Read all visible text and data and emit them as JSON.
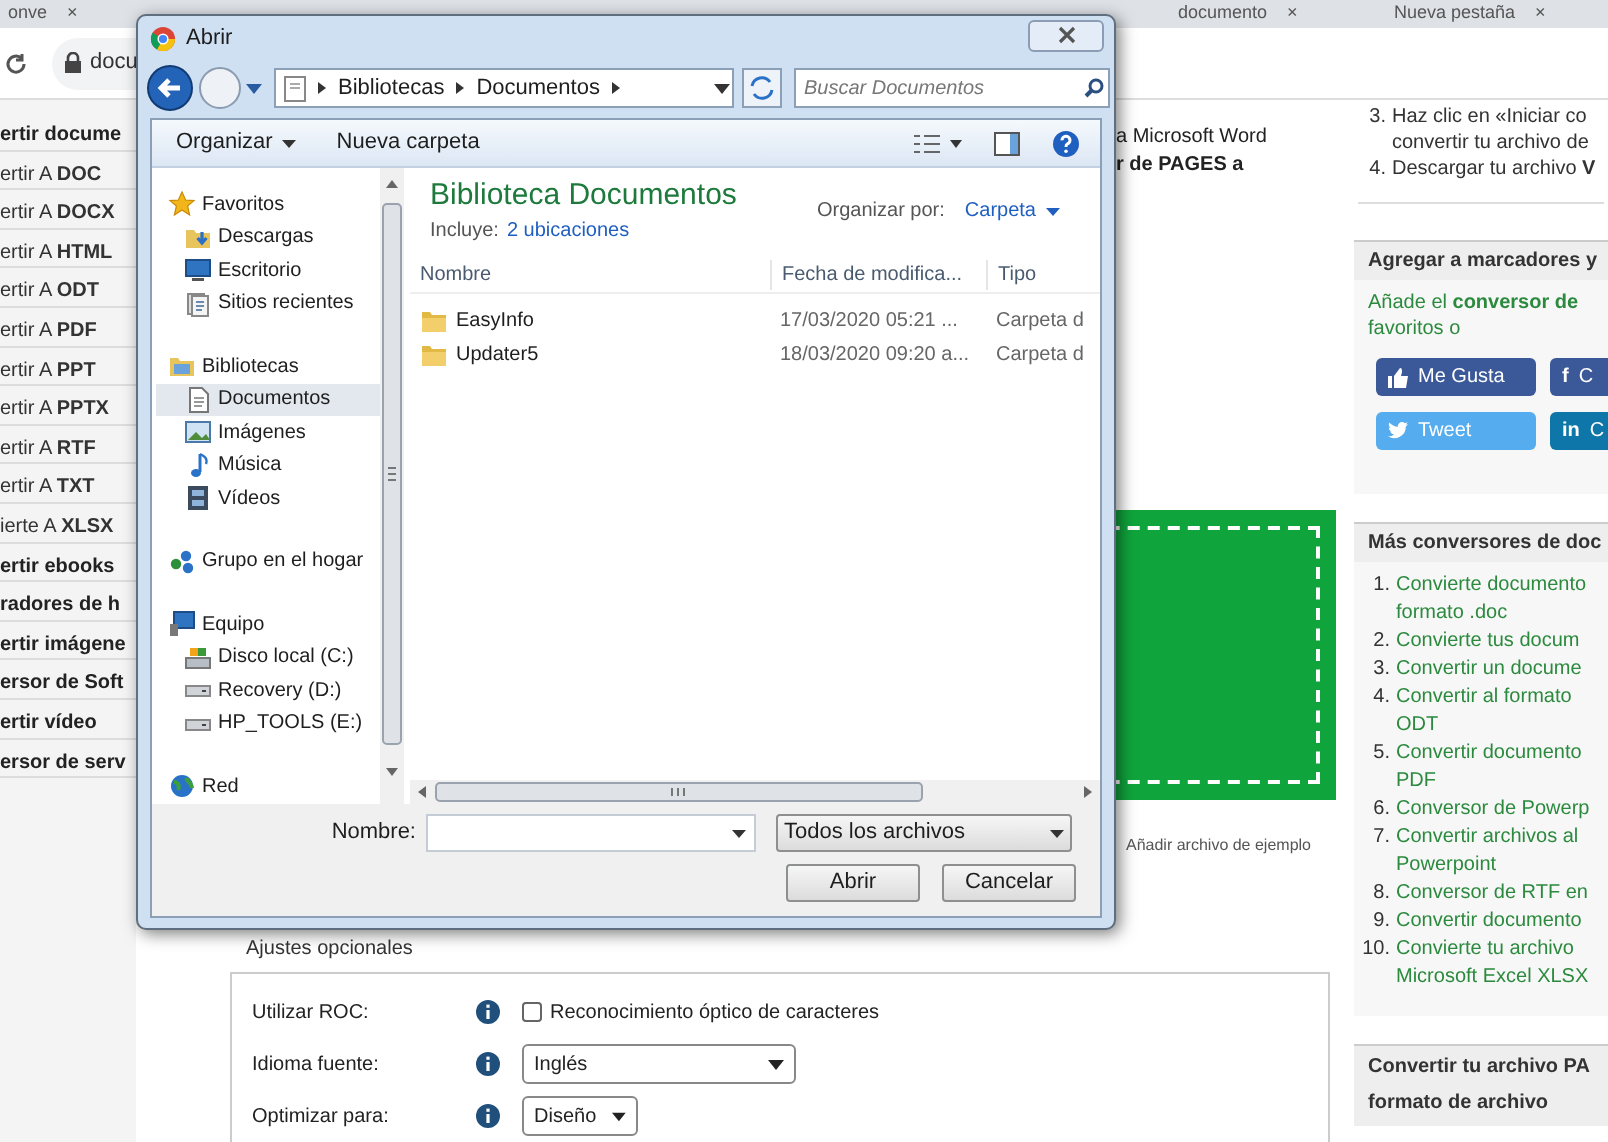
{
  "browser": {
    "tabs": [
      {
        "label": "onve",
        "close": "×"
      },
      {
        "label": "documento",
        "close": "×"
      },
      {
        "label": "Nueva pestaña",
        "close": "×"
      }
    ],
    "address": "docu"
  },
  "sidebar": {
    "items": [
      {
        "kind": "heading",
        "text": "**ertir docume**"
      },
      {
        "kind": "link",
        "text": "ertir A **DOC**"
      },
      {
        "kind": "link",
        "text": "ertir A **DOCX**"
      },
      {
        "kind": "link",
        "text": "ertir A **HTML**"
      },
      {
        "kind": "link",
        "text": "ertir A **ODT**"
      },
      {
        "kind": "link",
        "text": "ertir A **PDF**"
      },
      {
        "kind": "link",
        "text": "ertir A **PPT**"
      },
      {
        "kind": "link",
        "text": "ertir A **PPTX**"
      },
      {
        "kind": "link",
        "text": "ertir A **RTF**"
      },
      {
        "kind": "link",
        "text": "ertir A **TXT**"
      },
      {
        "kind": "link",
        "text": "ierte A **XLSX**"
      },
      {
        "kind": "heading",
        "text": "**ertir ebooks**"
      },
      {
        "kind": "heading",
        "text": "**radores de h**"
      },
      {
        "kind": "heading",
        "text": "**ertir imágene**"
      },
      {
        "kind": "heading",
        "text": "**ersor de Soft**"
      },
      {
        "kind": "heading",
        "text": "**ertir vídeo**"
      },
      {
        "kind": "heading",
        "text": "**ersor de serv**"
      }
    ]
  },
  "content": {
    "lines": [
      "a Microsoft Word",
      "**r de PAGES a**"
    ],
    "sample_link": "Añadir archivo de ejemplo",
    "options": {
      "title": "Ajustes opcionales",
      "rows": [
        {
          "kind": "checkbox",
          "label": "Utilizar ROC:",
          "text": "Reconocimiento óptico de caracteres",
          "checked": false
        },
        {
          "kind": "select",
          "label": "Idioma fuente:",
          "value": "Inglés"
        },
        {
          "kind": "select",
          "label": "Optimizar para:",
          "value": "Diseño"
        }
      ]
    }
  },
  "right_column": {
    "steps": [
      {
        "number": "3.",
        "lines": [
          "Haz clic en «Iniciar co",
          "convertir tu archivo de"
        ]
      },
      {
        "number": "4.",
        "lines": [
          "Descargar tu archivo **V**"
        ]
      }
    ],
    "bookmarks": {
      "title": "Agregar a marcadores y",
      "lines": [
        "Añade el **conversor de**",
        "favoritos o"
      ],
      "buttons": [
        {
          "kind": "like",
          "label": "Me Gusta",
          "color": "#3b5998"
        },
        {
          "kind": "letter",
          "glyph": "f",
          "label": "C",
          "color": "#3b5998"
        },
        {
          "kind": "tweet",
          "label": "Tweet",
          "color": "#55acee"
        },
        {
          "kind": "letter",
          "glyph": "in",
          "label": "C",
          "color": "#0e76a8"
        }
      ]
    },
    "more_converters": {
      "title": "Más conversores de doc",
      "items": [
        {
          "number": "1.",
          "lines": [
            "Convierte documento",
            "formato .doc"
          ]
        },
        {
          "number": "2.",
          "lines": [
            "Convierte tus docum"
          ]
        },
        {
          "number": "3.",
          "lines": [
            "Convertir un docume"
          ]
        },
        {
          "number": "4.",
          "lines": [
            "Convertir al formato",
            "ODT"
          ]
        },
        {
          "number": "5.",
          "lines": [
            "Convertir documento",
            "PDF"
          ]
        },
        {
          "number": "6.",
          "lines": [
            "Conversor de Powerp"
          ]
        },
        {
          "number": "7.",
          "lines": [
            "Convertir archivos al",
            "Powerpoint"
          ]
        },
        {
          "number": "8.",
          "lines": [
            "Conversor de RTF en"
          ]
        },
        {
          "number": "9.",
          "lines": [
            "Convertir documento"
          ]
        },
        {
          "number": "10.",
          "lines": [
            "Convierte tu archivo",
            "Microsoft Excel XLSX"
          ]
        }
      ]
    },
    "convert_box": {
      "lines": [
        "Convertir tu archivo PA",
        "formato de archivo"
      ]
    }
  },
  "dialog": {
    "title": "Abrir",
    "breadcrumb": [
      "Bibliotecas",
      "Documentos"
    ],
    "search": {
      "placeholder": "Buscar Documentos"
    },
    "toolbar": {
      "organize": "Organizar",
      "new_folder": "Nueva carpeta"
    },
    "nav": [
      {
        "kind": "star",
        "label": "Favoritos",
        "selected": false,
        "children": [
          {
            "kind": "downloads",
            "label": "Descargas",
            "selected": false
          },
          {
            "kind": "desktop",
            "label": "Escritorio",
            "selected": false
          },
          {
            "kind": "recent",
            "label": "Sitios recientes",
            "selected": false
          }
        ]
      },
      {
        "kind": "library",
        "label": "Bibliotecas",
        "selected": false,
        "children": [
          {
            "kind": "document",
            "label": "Documentos",
            "selected": true
          },
          {
            "kind": "pictures",
            "label": "Imágenes",
            "selected": false
          },
          {
            "kind": "music",
            "label": "Música",
            "selected": false
          },
          {
            "kind": "videos",
            "label": "Vídeos",
            "selected": false
          }
        ]
      },
      {
        "kind": "homegroup",
        "label": "Grupo en el hogar",
        "selected": false
      },
      {
        "kind": "computer",
        "label": "Equipo",
        "selected": false,
        "children": [
          {
            "kind": "disk",
            "label": "Disco local (C:)",
            "selected": false
          },
          {
            "kind": "drive",
            "label": "Recovery (D:)",
            "selected": false
          },
          {
            "kind": "drive",
            "label": "HP_TOOLS (E:)",
            "selected": false
          }
        ]
      },
      {
        "kind": "network",
        "label": "Red",
        "selected": false
      }
    ],
    "library": {
      "title": "Biblioteca Documentos",
      "includes_label": "Incluye:",
      "includes_link": "2 ubicaciones",
      "arrange_label": "Organizar por:",
      "arrange_value": "Carpeta"
    },
    "columns": [
      "Nombre",
      "Fecha de modifica...",
      "Tipo"
    ],
    "rows": [
      {
        "name": "EasyInfo",
        "date": "17/03/2020 05:21 ...",
        "type": "Carpeta d"
      },
      {
        "name": "Updater5",
        "date": "18/03/2020 09:20 a...",
        "type": "Carpeta d"
      }
    ],
    "filename_label": "Nombre:",
    "filter": "Todos los archivos",
    "buttons": [
      "Abrir",
      "Cancelar"
    ]
  }
}
